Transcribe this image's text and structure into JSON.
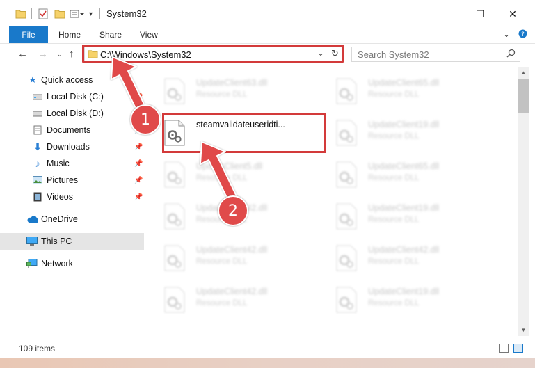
{
  "window": {
    "title": "System32",
    "controls": {
      "minimize": "—",
      "maximize": "☐",
      "close": "✕"
    }
  },
  "ribbon": {
    "tabs": [
      "File",
      "Home",
      "Share",
      "View"
    ],
    "expand_icon": "chevron-down-icon",
    "help_icon": "help-icon"
  },
  "address_bar": {
    "path": "C:\\Windows\\System32"
  },
  "search": {
    "placeholder": "Search System32"
  },
  "sidebar": {
    "items": [
      {
        "label": "Quick access",
        "icon": "star-icon",
        "pinned": false
      },
      {
        "label": "Local Disk (C:)",
        "icon": "drive-icon",
        "pinned": true
      },
      {
        "label": "Local Disk (D:)",
        "icon": "drive-icon",
        "pinned": false
      },
      {
        "label": "Documents",
        "icon": "documents-icon",
        "pinned": true
      },
      {
        "label": "Downloads",
        "icon": "downloads-icon",
        "pinned": true
      },
      {
        "label": "Music",
        "icon": "music-icon",
        "pinned": true
      },
      {
        "label": "Pictures",
        "icon": "pictures-icon",
        "pinned": true
      },
      {
        "label": "Videos",
        "icon": "videos-icon",
        "pinned": true
      },
      {
        "label": "OneDrive",
        "icon": "cloud-icon",
        "pinned": false
      },
      {
        "label": "This PC",
        "icon": "computer-icon",
        "pinned": false,
        "selected": true
      },
      {
        "label": "Network",
        "icon": "network-icon",
        "pinned": false
      }
    ]
  },
  "files": [
    {
      "name": "UpdateClient63.dll",
      "type": "Resource DLL"
    },
    {
      "name": "UpdateClient65.dll",
      "type": "Resource DLL"
    },
    {
      "name": "steamvalidateuseridti...",
      "type": ""
    },
    {
      "name": "UpdateClient19.dll",
      "type": "Resource DLL"
    },
    {
      "name": "UpdateClient5.dll",
      "type": "Resource DLL"
    },
    {
      "name": "UpdateClient65.dll",
      "type": "Resource DLL"
    },
    {
      "name": "UpdateClient42.dll",
      "type": "Resource DLL"
    },
    {
      "name": "UpdateClient19.dll",
      "type": "Resource DLL"
    },
    {
      "name": "UpdateClient42.dll",
      "type": "Resource DLL"
    },
    {
      "name": "UpdateClient42.dll",
      "type": "Resource DLL"
    },
    {
      "name": "UpdateClient42.dll",
      "type": "Resource DLL"
    },
    {
      "name": "UpdateClient19.dll",
      "type": "Resource DLL"
    }
  ],
  "status": {
    "count": "109 items"
  },
  "annotations": {
    "step1": "1",
    "step2": "2",
    "color": "#e04a4a"
  },
  "colors": {
    "accent": "#1979ca",
    "highlight": "#d33a3a"
  }
}
